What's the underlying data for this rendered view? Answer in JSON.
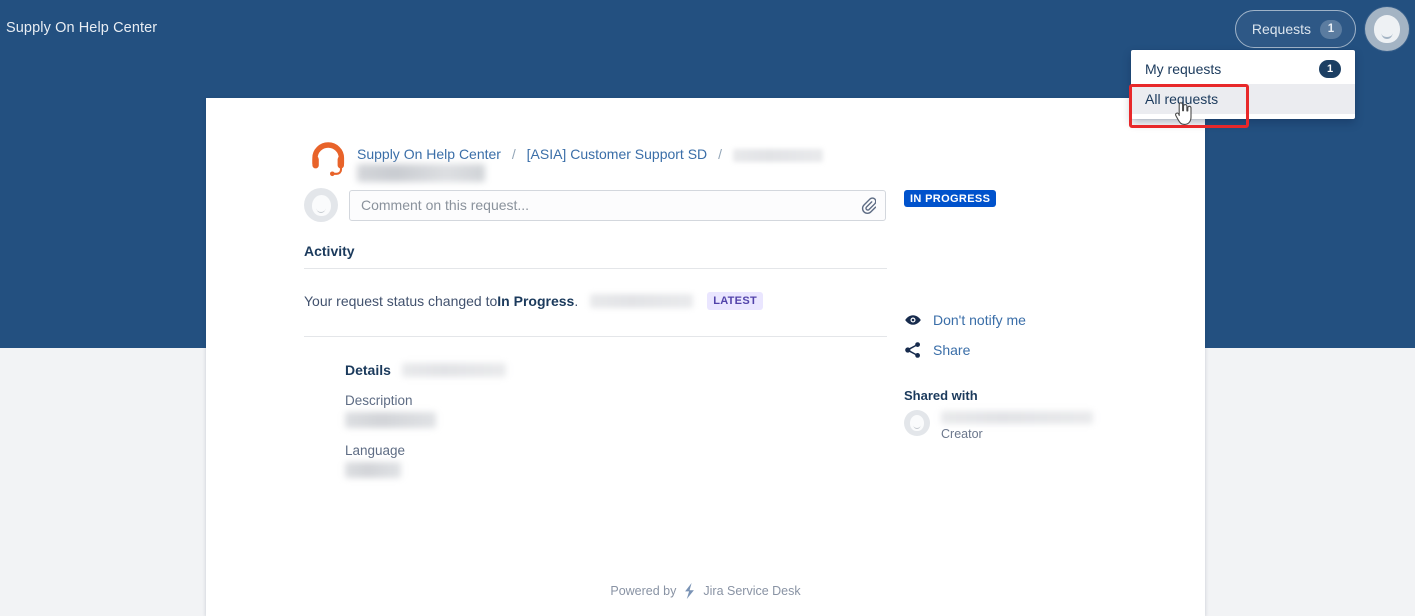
{
  "header": {
    "site_title": "Supply On Help Center",
    "requests_button": {
      "label": "Requests",
      "count": "1"
    },
    "avatar_name": "user-avatar"
  },
  "dropdown": {
    "items": [
      {
        "label": "My requests",
        "count": "1",
        "active": false
      },
      {
        "label": "All requests",
        "count": "",
        "active": true
      }
    ]
  },
  "breadcrumb": {
    "items": [
      {
        "label": "Supply On Help Center",
        "type": "link"
      },
      {
        "label": "[ASIA] Customer Support SD",
        "type": "link"
      },
      {
        "label": "",
        "type": "redacted"
      }
    ],
    "separator": "/"
  },
  "request": {
    "title_redacted": true
  },
  "comment": {
    "placeholder": "Comment on this request...",
    "attach_icon": "paperclip-icon"
  },
  "activity": {
    "heading": "Activity",
    "entry_prefix": "Your request status changed to ",
    "entry_status": "In Progress",
    "entry_suffix": ".",
    "badge": "LATEST"
  },
  "details": {
    "heading": "Details",
    "fields": [
      {
        "label": "Description",
        "value_redacted": true
      },
      {
        "label": "Language",
        "value_redacted": true
      }
    ]
  },
  "sidebar": {
    "status": "IN PROGRESS",
    "actions": [
      {
        "label": "Don't notify me",
        "icon": "eye-icon"
      },
      {
        "label": "Share",
        "icon": "share-icon"
      }
    ],
    "shared_with_heading": "Shared with",
    "person": {
      "email_redacted": true,
      "role": "Creator"
    }
  },
  "footer": {
    "powered_by": "Powered by",
    "product": "Jira Service Desk",
    "icon": "jira-service-desk-icon"
  },
  "colors": {
    "header_blue": "#235080",
    "page_bg": "#f2f3f5",
    "link_blue": "#3a6ea8",
    "status_blue": "#0052cc",
    "latest_purple_bg": "#eae6ff",
    "latest_purple_text": "#5243aa",
    "logo_orange": "#e8632a",
    "highlight_red": "#e8282a"
  }
}
